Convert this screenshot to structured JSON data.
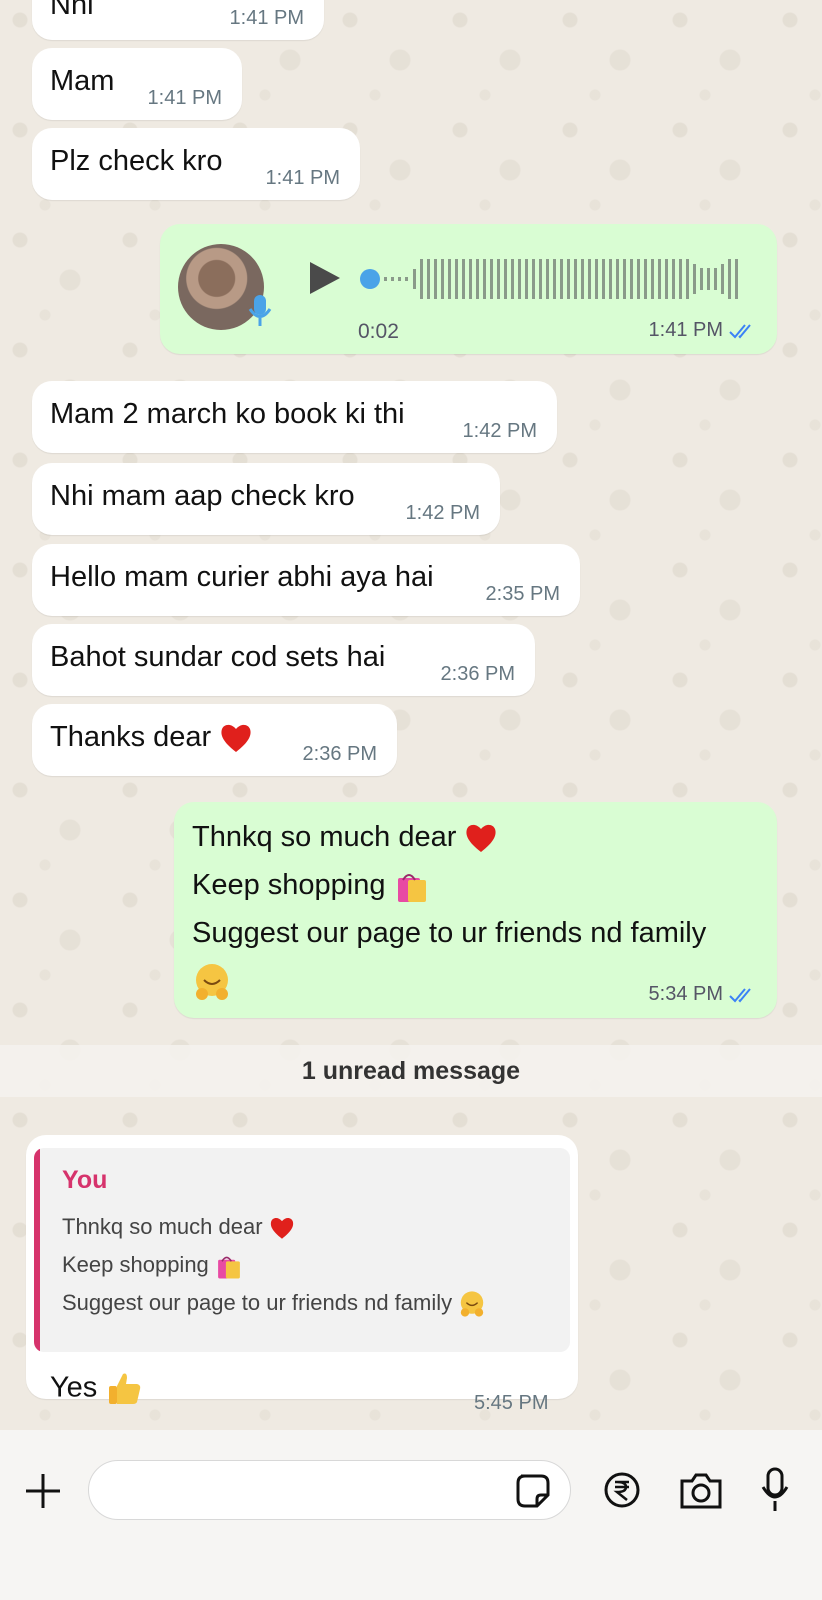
{
  "messages": [
    {
      "text": "Nhi",
      "time": "1:41 PM"
    },
    {
      "text": "Mam",
      "time": "1:41 PM"
    },
    {
      "text": "Plz check kro",
      "time": "1:41 PM"
    },
    {
      "voice_duration": "0:02",
      "time": "1:41 PM"
    },
    {
      "text": "Mam 2 march ko book ki thi",
      "time": "1:42 PM"
    },
    {
      "text": "Nhi mam aap check kro",
      "time": "1:42 PM"
    },
    {
      "text": "Hello mam curier abhi aya hai",
      "time": "2:35 PM"
    },
    {
      "text": "Bahot sundar cod sets hai",
      "time": "2:36 PM"
    },
    {
      "text": "Thanks dear",
      "time": "2:36 PM"
    },
    {
      "lines": [
        "Thnkq so much dear",
        "Keep shopping",
        "Suggest our page to ur friends nd family"
      ],
      "time": "5:34 PM"
    }
  ],
  "unread_banner": "1 unread message",
  "reply": {
    "quote_author": "You",
    "quote_lines": [
      "Thnkq so much dear",
      "Keep shopping",
      "Suggest our page to ur friends nd family"
    ],
    "text": "Yes",
    "time": "5:45 PM"
  },
  "input": {
    "placeholder": ""
  },
  "icons": [
    "plus-icon",
    "sticker-icon",
    "rupee-icon",
    "camera-icon",
    "mic-icon",
    "play-icon",
    "double-check-icon"
  ],
  "colors": {
    "outgoing": "#d9fdd3",
    "incoming": "#ffffff",
    "tick_blue": "#3b82f6",
    "quote_accent": "#d6336c"
  }
}
